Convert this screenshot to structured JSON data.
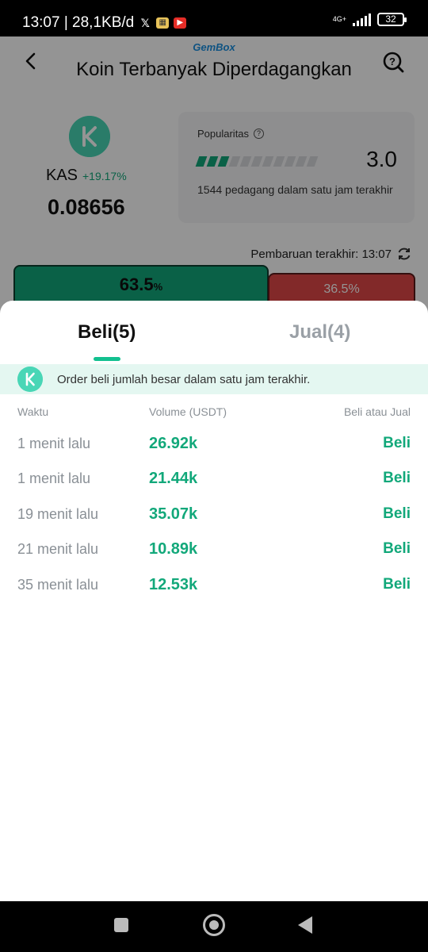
{
  "status_bar": {
    "time_speed": "13:07 | 28,1KB/d",
    "network": "4G+",
    "battery": "32"
  },
  "header": {
    "brand": "GemBox",
    "title": "Koin Terbanyak Diperdagangkan"
  },
  "coin": {
    "name": "KAS",
    "change": "+19.17%",
    "price": "0.08656"
  },
  "popularity": {
    "label": "Popularitas",
    "score": "3.0",
    "level_segments_filled": 3,
    "level_segments_total": 11,
    "description": "1544 pedagang dalam satu jam terakhir"
  },
  "last_update": "Pembaruan terakhir: 13:07",
  "ratio": {
    "buy_value": "63.5",
    "buy_unit": "%",
    "sell": "36.5%"
  },
  "sheet": {
    "tab_buy": "Beli(5)",
    "tab_sell": "Jual(4)",
    "notice": "Order beli jumlah besar dalam satu jam terakhir.",
    "columns": [
      "Waktu",
      "Volume (USDT)",
      "Beli atau Jual"
    ],
    "rows": [
      {
        "time": "1 menit lalu",
        "volume": "26.92k",
        "side": "Beli"
      },
      {
        "time": "1 menit lalu",
        "volume": "21.44k",
        "side": "Beli"
      },
      {
        "time": "19 menit lalu",
        "volume": "35.07k",
        "side": "Beli"
      },
      {
        "time": "21 menit lalu",
        "volume": "10.89k",
        "side": "Beli"
      },
      {
        "time": "35 menit lalu",
        "volume": "12.53k",
        "side": "Beli"
      }
    ]
  },
  "colors": {
    "accent_green": "#12a87a",
    "sell_red": "#e04747",
    "kaspa_teal": "#49d6b6"
  }
}
